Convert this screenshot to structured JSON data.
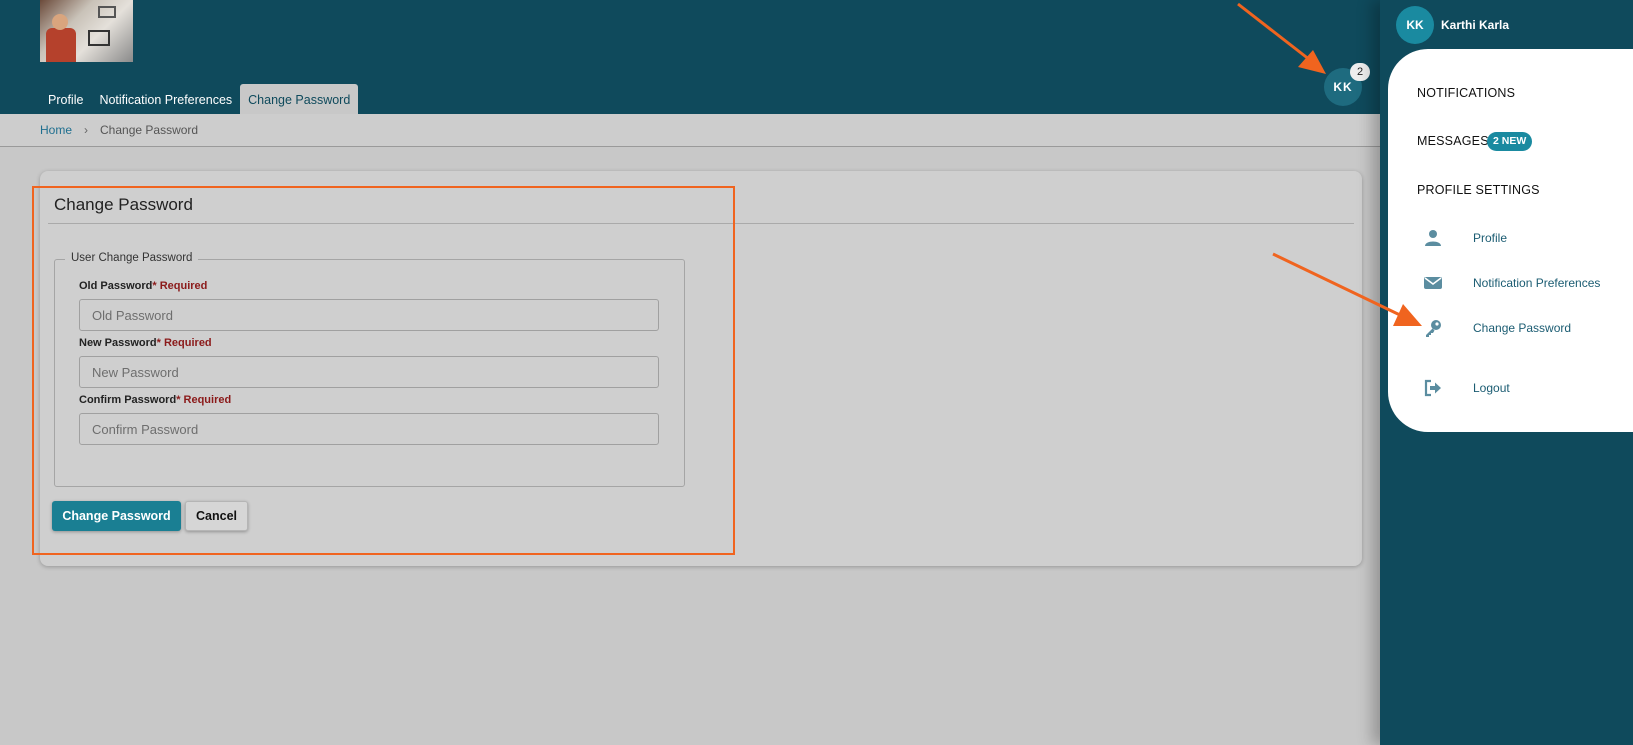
{
  "header": {
    "tabs": [
      "Profile",
      "Notification Preferences",
      "Change Password"
    ],
    "avatar_initials": "KK",
    "notification_count": "2"
  },
  "breadcrumb": {
    "home": "Home",
    "separator": "›",
    "current": "Change Password"
  },
  "card": {
    "title": "Change Password",
    "fieldset_legend": "User Change Password",
    "fields": [
      {
        "label": "Old Password",
        "required": "* Required",
        "placeholder": "Old Password"
      },
      {
        "label": "New Password",
        "required": "* Required",
        "placeholder": "New Password"
      },
      {
        "label": "Confirm Password",
        "required": "* Required",
        "placeholder": "Confirm Password"
      }
    ],
    "submit_label": "Change Password",
    "cancel_label": "Cancel"
  },
  "panel": {
    "avatar_initials": "KK",
    "user_name": "Karthi Karla",
    "notifications_heading": "NOTIFICATIONS",
    "messages_heading": "MESSAGES",
    "messages_badge": "2 NEW",
    "profile_settings_heading": "PROFILE SETTINGS",
    "items": [
      {
        "label": "Profile",
        "icon": "person-icon"
      },
      {
        "label": "Notification Preferences",
        "icon": "envelope-icon"
      },
      {
        "label": "Change Password",
        "icon": "key-icon"
      },
      {
        "label": "Logout",
        "icon": "logout-icon"
      }
    ]
  },
  "colors": {
    "header_bg": "#0f4a5c",
    "accent": "#1a8aa0",
    "annotation": "#f0641f"
  }
}
